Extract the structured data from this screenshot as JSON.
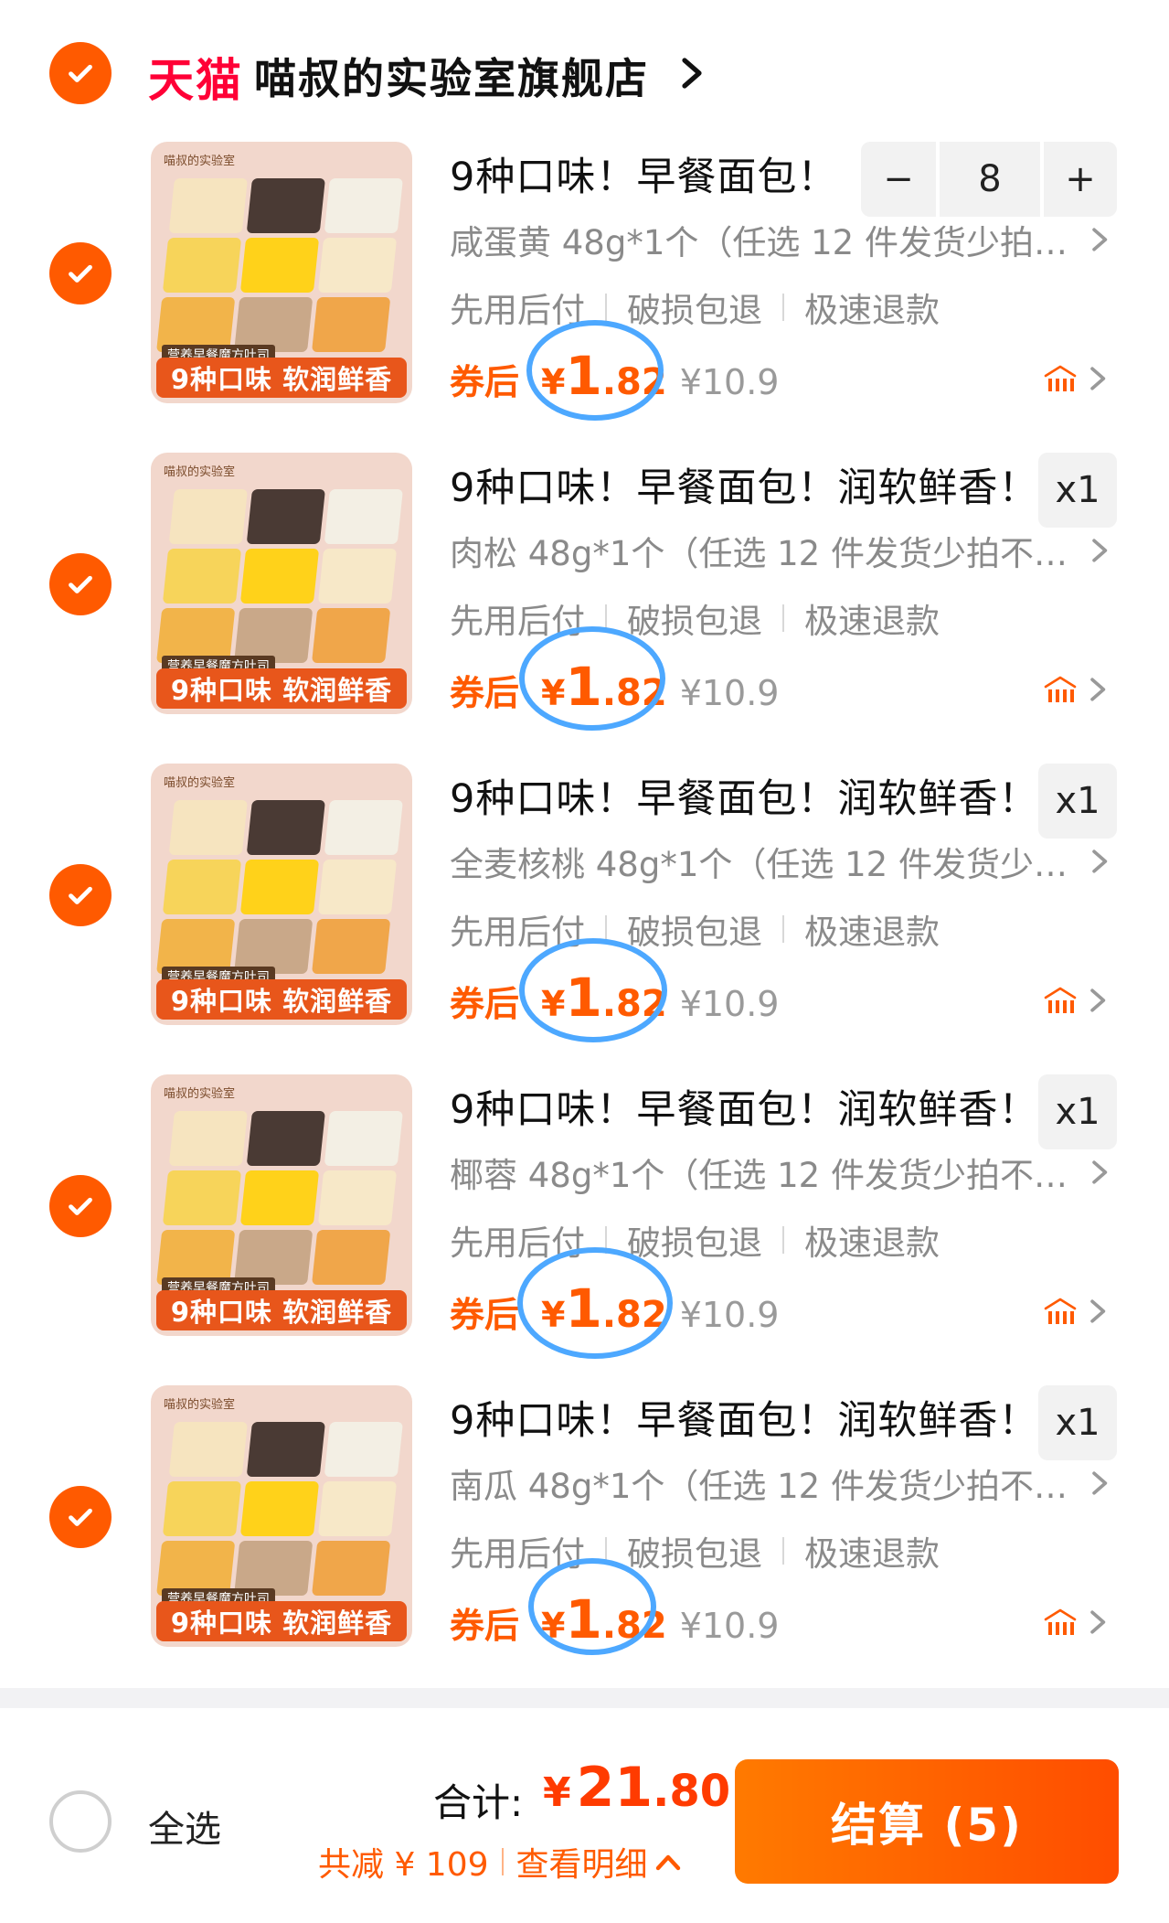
{
  "store": {
    "platform": "天猫",
    "name": "喵叔的实验室旗舰店"
  },
  "product_image": {
    "brand": "喵叔的实验室",
    "subtitle": "营养早餐魔方吐司",
    "banner": "9种口味 软润鲜香"
  },
  "items": [
    {
      "title": "9种口味！早餐面包！",
      "variant": "咸蛋黄 48g*1个（任选 12 件发货少拍…",
      "services": [
        "先用后付",
        "破损包退",
        "极速退款"
      ],
      "price_label": "券后",
      "price_symbol": "¥",
      "price_int": "1",
      "price_dec": ".82",
      "original_price": "¥10.9",
      "quantity": "8",
      "qty_minus": "−",
      "qty_plus": "+"
    },
    {
      "title": "9种口味！早餐面包！润软鲜香！",
      "variant": "肉松 48g*1个（任选 12 件发货少拍不…",
      "services": [
        "先用后付",
        "破损包退",
        "极速退款"
      ],
      "price_label": "券后",
      "price_symbol": "¥",
      "price_int": "1",
      "price_dec": ".82",
      "original_price": "¥10.9",
      "quantity_label": "x1"
    },
    {
      "title": "9种口味！早餐面包！润软鲜香！",
      "variant": "全麦核桃 48g*1个（任选 12 件发货少…",
      "services": [
        "先用后付",
        "破损包退",
        "极速退款"
      ],
      "price_label": "券后",
      "price_symbol": "¥",
      "price_int": "1",
      "price_dec": ".82",
      "original_price": "¥10.9",
      "quantity_label": "x1"
    },
    {
      "title": "9种口味！早餐面包！润软鲜香！",
      "variant": "椰蓉 48g*1个（任选 12 件发货少拍不…",
      "services": [
        "先用后付",
        "破损包退",
        "极速退款"
      ],
      "price_label": "券后",
      "price_symbol": "¥",
      "price_int": "1",
      "price_dec": ".82",
      "original_price": "¥10.9",
      "quantity_label": "x1"
    },
    {
      "title": "9种口味！早餐面包！润软鲜香！",
      "variant": "南瓜 48g*1个（任选 12 件发货少拍不…",
      "services": [
        "先用后付",
        "破损包退",
        "极速退款"
      ],
      "price_label": "券后",
      "price_symbol": "¥",
      "price_int": "1",
      "price_dec": ".82",
      "original_price": "¥10.9",
      "quantity_label": "x1"
    }
  ],
  "bottom_bar": {
    "select_all": "全选",
    "total_label": "合计:",
    "total_symbol": "¥",
    "total_int": "21",
    "total_dec": ".80",
    "discount_text": "共减 ¥ 109",
    "detail_text": "查看明细",
    "checkout": "结算 (5)"
  },
  "colors": {
    "accent": "#ff5a00",
    "tmall_red": "#ff0036",
    "annotation_circle": "#4da8ff"
  }
}
